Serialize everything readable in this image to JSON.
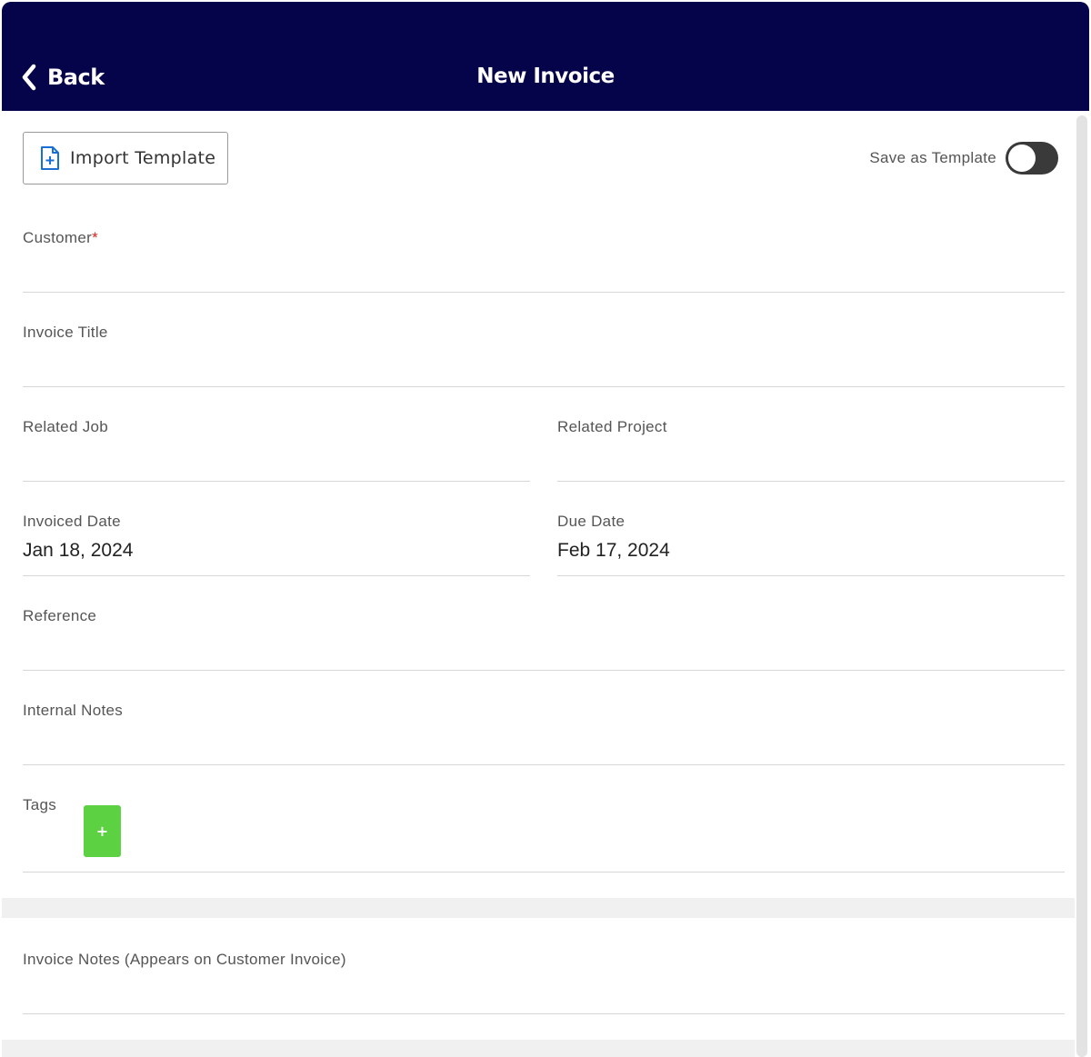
{
  "header": {
    "back_label": "Back",
    "title": "New Invoice",
    "background_color": "#05044a"
  },
  "toolbar": {
    "import_label": "Import Template",
    "import_icon": "file-plus-icon",
    "save_template_label": "Save as Template",
    "save_template_on": false
  },
  "form": {
    "customer": {
      "label": "Customer",
      "required_mark": "*",
      "value": ""
    },
    "invoice_title": {
      "label": "Invoice Title",
      "value": ""
    },
    "related_job": {
      "label": "Related Job",
      "value": ""
    },
    "related_project": {
      "label": "Related Project",
      "value": ""
    },
    "invoiced_date": {
      "label": "Invoiced Date",
      "value": "Jan 18, 2024"
    },
    "due_date": {
      "label": "Due Date",
      "value": "Feb 17, 2024"
    },
    "reference": {
      "label": "Reference",
      "value": ""
    },
    "internal_notes": {
      "label": "Internal Notes",
      "value": ""
    },
    "tags": {
      "label": "Tags",
      "add_label": "+",
      "add_color": "#5cd142"
    },
    "invoice_notes": {
      "label": "Invoice Notes (Appears on Customer Invoice)",
      "value": ""
    }
  }
}
